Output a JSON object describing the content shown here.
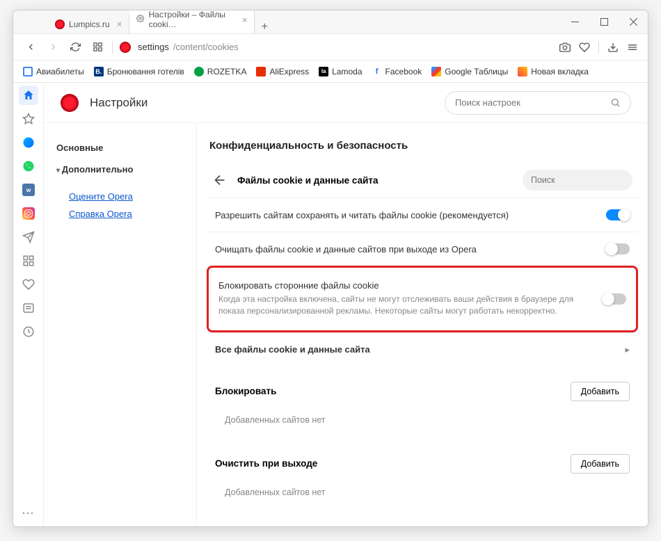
{
  "tabs": [
    {
      "title": "Lumpics.ru"
    },
    {
      "title": "Настройки – Файлы cooki…"
    }
  ],
  "url": {
    "scheme": "settings",
    "rest": "/content/cookies"
  },
  "bookmarks": [
    {
      "label": "Авиабилеты",
      "color": "#fff",
      "border": "#4285f4"
    },
    {
      "label": "Бронювання готелів",
      "color": "#003580"
    },
    {
      "label": "ROZETKA",
      "color": "#00a046"
    },
    {
      "label": "AliExpress",
      "color": "#e62e04"
    },
    {
      "label": "Lamoda",
      "color": "#000"
    },
    {
      "label": "Facebook",
      "color": "#1877f2"
    },
    {
      "label": "Google Таблицы",
      "color": "#34a853"
    },
    {
      "label": "Новая вкладка",
      "color": "#ffc107"
    }
  ],
  "settings_title": "Настройки",
  "search_placeholder": "Поиск настроек",
  "nav": {
    "basic": "Основные",
    "advanced": "Дополнительно",
    "rate": "Оцените Opera",
    "help": "Справка Opera"
  },
  "section_title": "Конфиденциальность и безопасность",
  "sub_title": "Файлы cookie и данные сайта",
  "sub_search": "Поиск",
  "rows": {
    "allow": "Разрешить сайтам сохранять и читать файлы cookie (рекомендуется)",
    "clear": "Очищать файлы cookie и данные сайтов при выходе из Opera",
    "block_title": "Блокировать сторонние файлы cookie",
    "block_desc": "Когда эта настройка включена, сайты не могут отслеживать ваши действия в браузере для показа персонализированной рекламы. Некоторые сайты могут работать некорректно.",
    "all": "Все файлы cookie и данные сайта"
  },
  "block_section": "Блокировать",
  "clear_exit_section": "Очистить при выходе",
  "add_button": "Добавить",
  "empty_msg": "Добавленных сайтов нет"
}
